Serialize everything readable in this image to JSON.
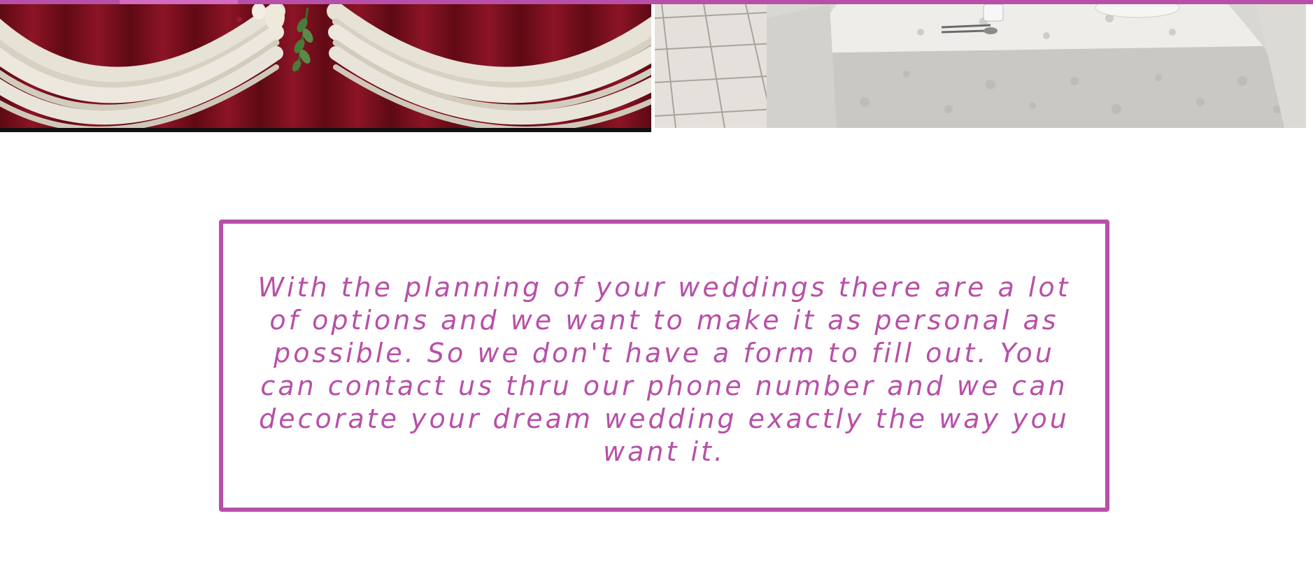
{
  "colors": {
    "accent": "#b84fa8",
    "accent_light": "#d56bc0"
  },
  "gallery": {
    "images": [
      {
        "name": "wedding-drapery-backdrop-photo",
        "alt": ""
      },
      {
        "name": "table-setting-photo",
        "alt": ""
      }
    ]
  },
  "info": {
    "text": "With the planning of your weddings there are a lot of options and we want to make it as personal as possible. So we don't have a form to fill out. You can contact us thru our phone number and we can decorate your dream wedding exactly the way you want it."
  }
}
